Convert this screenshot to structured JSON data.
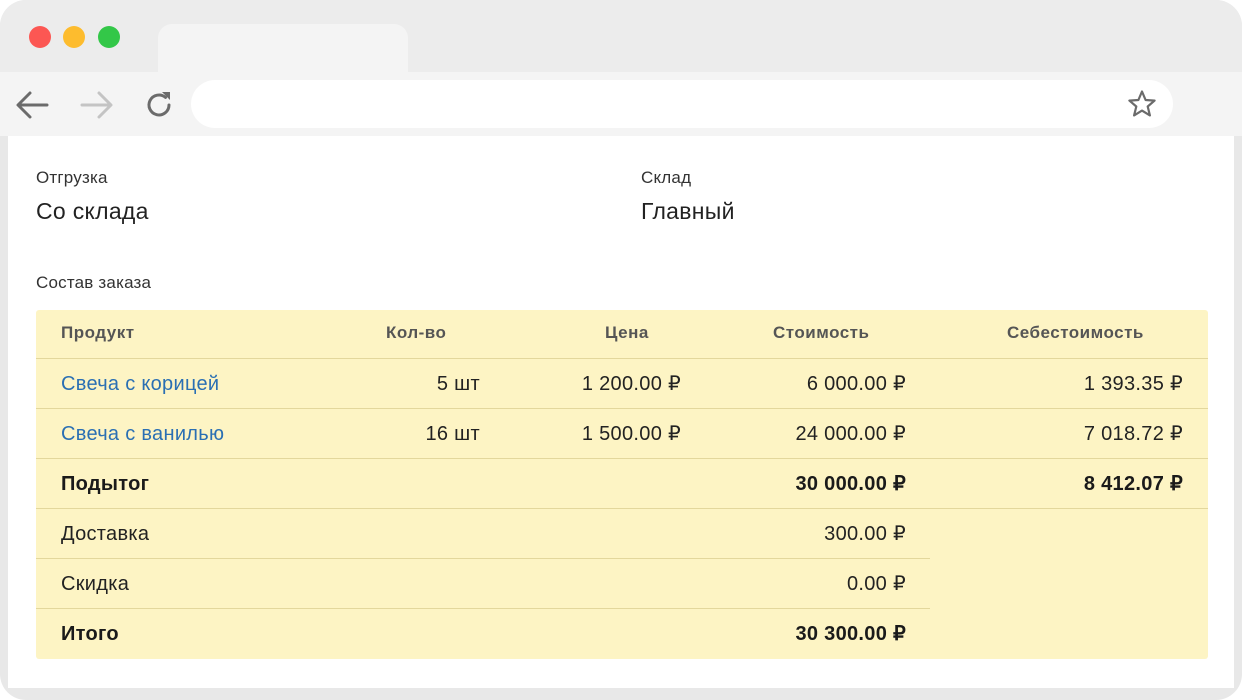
{
  "form": {
    "shipment_label": "Отгрузка",
    "shipment_value": "Со склада",
    "warehouse_label": "Склад",
    "warehouse_value": "Главный",
    "section_title": "Состав заказа"
  },
  "table": {
    "headers": {
      "product": "Продукт",
      "qty": "Кол-во",
      "price": "Цена",
      "cost": "Стоимость",
      "prime_cost": "Себестоимость"
    },
    "rows": [
      {
        "product": "Свеча с корицей",
        "qty": "5 шт",
        "price": "1 200.00 ₽",
        "cost": "6 000.00 ₽",
        "prime_cost": "1 393.35 ₽"
      },
      {
        "product": "Свеча с ванилью",
        "qty": "16 шт",
        "price": "1 500.00 ₽",
        "cost": "24 000.00 ₽",
        "prime_cost": "7 018.72 ₽"
      }
    ],
    "subtotal": {
      "label": "Подытог",
      "cost": "30 000.00 ₽",
      "prime_cost": "8 412.07 ₽"
    },
    "delivery": {
      "label": "Доставка",
      "cost": "300.00 ₽"
    },
    "discount": {
      "label": "Скидка",
      "cost": "0.00 ₽"
    },
    "total": {
      "label": "Итого",
      "cost": "30 300.00 ₽"
    }
  },
  "browser": {
    "icons": {
      "back": "arrow-left-icon",
      "forward": "arrow-right-icon",
      "reload": "reload-icon",
      "bookmark": "star-icon"
    },
    "colors": {
      "close": "#fc5753",
      "minimize": "#fdbc2e",
      "maximize": "#33c748",
      "table_bg": "#fdf4c4",
      "link": "#2a6fb3"
    }
  }
}
